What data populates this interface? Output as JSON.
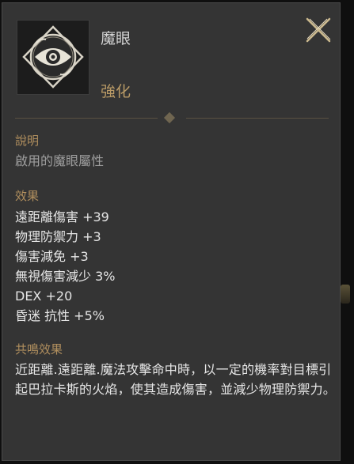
{
  "item": {
    "name": "魔眼",
    "type": "強化",
    "icon": "eye-emblem-icon"
  },
  "sections": {
    "description_title": "說明",
    "description_text": "啟用的魔眼屬性",
    "effects_title": "效果",
    "effects": [
      "遠距離傷害 +39",
      "物理防禦力 +3",
      "傷害減免 +3",
      "無視傷害減少 3%",
      "DEX +20",
      "昏迷 抗性 +5%"
    ],
    "resonance_title": "共鳴效果",
    "resonance_text": "近距離.遠距離.魔法攻擊命中時，以一定的機率對目標引起巴拉卡斯的火焰，使其造成傷害，並減少物理防禦力。"
  },
  "colors": {
    "panel": "#343434",
    "accent_gold": "#b18f5e",
    "text": "#e6e6e6",
    "muted": "#9e9e9e"
  }
}
